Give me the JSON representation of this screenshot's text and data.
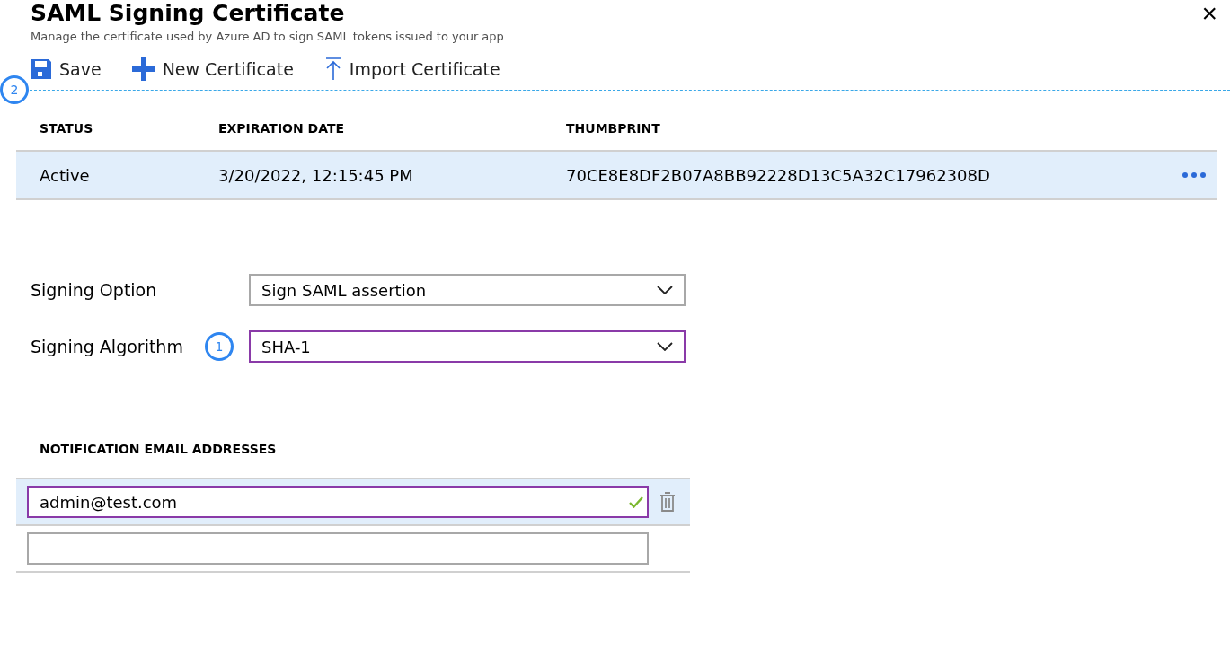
{
  "panel": {
    "title": "SAML Signing Certificate",
    "subtitle": "Manage the certificate used by Azure AD to sign SAML tokens issued to your app",
    "close": "×"
  },
  "toolbar": {
    "marker": "2",
    "items": [
      {
        "kind": "save",
        "label": "Save"
      },
      {
        "kind": "new",
        "label": "New Certificate"
      },
      {
        "kind": "import",
        "label": "Import Certificate"
      }
    ]
  },
  "table": {
    "columns": [
      "STATUS",
      "EXPIRATION DATE",
      "THUMBPRINT"
    ],
    "rows": [
      {
        "cells": [
          "Active",
          "3/20/2022, 12:15:45 PM",
          "70CE8E8DF2B07A8BB92228D13C5A32C17962308D"
        ],
        "selected": true
      }
    ]
  },
  "fields": [
    {
      "label": "Signing Option",
      "value": "Sign SAML assertion",
      "focused": false
    },
    {
      "label": "Signing Algorithm",
      "value": "SHA-1",
      "focused": true,
      "marker": "1"
    }
  ],
  "notification": {
    "heading": "NOTIFICATION EMAIL ADDRESSES",
    "emails": [
      {
        "value": "admin@test.com",
        "valid": true,
        "selected": true
      },
      {
        "valid": false,
        "selected": false
      }
    ]
  }
}
